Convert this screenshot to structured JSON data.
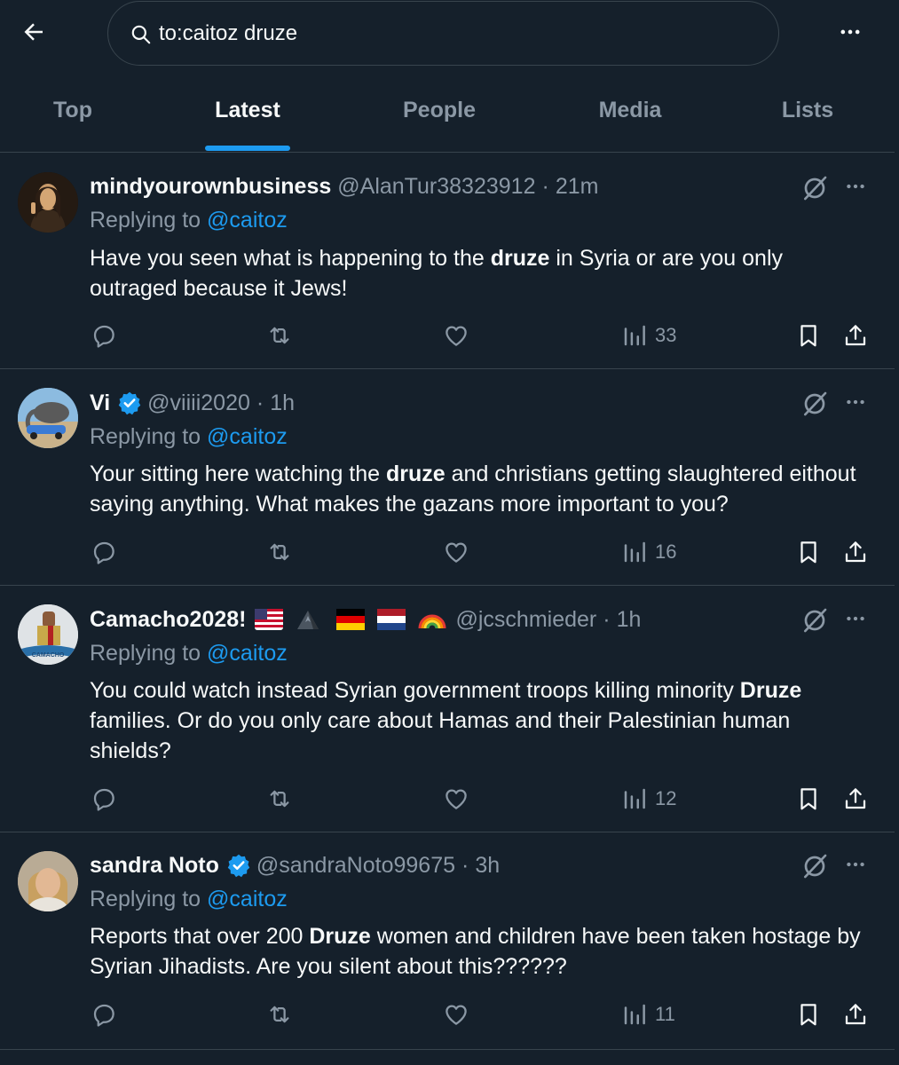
{
  "search": {
    "query": "to:caitoz druze"
  },
  "tabs": [
    {
      "label": "Top"
    },
    {
      "label": "Latest"
    },
    {
      "label": "People"
    },
    {
      "label": "Media"
    },
    {
      "label": "Lists"
    }
  ],
  "active_tab": "Latest",
  "colors": {
    "background": "#15202b",
    "accent": "#1d9bf0",
    "muted": "#8b98a5",
    "text": "#f7f9f9",
    "divider": "#38444d"
  },
  "replying_prefix": "Replying to",
  "tweets": [
    {
      "display_name": "mindyourownbusiness",
      "handle": "@AlanTur38323912",
      "time": "21m",
      "reply_to": "@caitoz",
      "text_parts": [
        "Have you seen what is happening to the ",
        "druze",
        " in Syria or are you only outraged because it Jews!"
      ],
      "views": "33",
      "verified": false
    },
    {
      "display_name": "Vi",
      "handle": "@viiii2020",
      "time": "1h",
      "reply_to": "@caitoz",
      "text_parts": [
        "Your sitting here watching the ",
        "druze",
        " and christians getting  slaughtered eithout saying anything. What makes the gazans more important to you?"
      ],
      "views": "16",
      "verified": true
    },
    {
      "display_name": "Camacho2028!",
      "handle": "@jcschmieder",
      "time": "1h",
      "reply_to": "@caitoz",
      "text_parts": [
        "You could watch instead Syrian government troops killing minority ",
        "Druze",
        " families. Or do you only care about Hamas and their Palestinian human shields?"
      ],
      "views": "12",
      "verified": false,
      "flag_icons": [
        "us-flag-icon",
        "mountain-icon",
        "germany-flag-icon",
        "netherlands-flag-icon",
        "rainbow-icon"
      ],
      "avatar_text": "CAMACHO"
    },
    {
      "display_name": "sandra Noto",
      "handle": "@sandraNoto99675",
      "time": "3h",
      "reply_to": "@caitoz",
      "text_parts": [
        "Reports that over 200 ",
        "Druze",
        " women and children have been taken hostage by Syrian Jihadists. Are you silent about this??????"
      ],
      "views": "11",
      "verified": true
    }
  ]
}
